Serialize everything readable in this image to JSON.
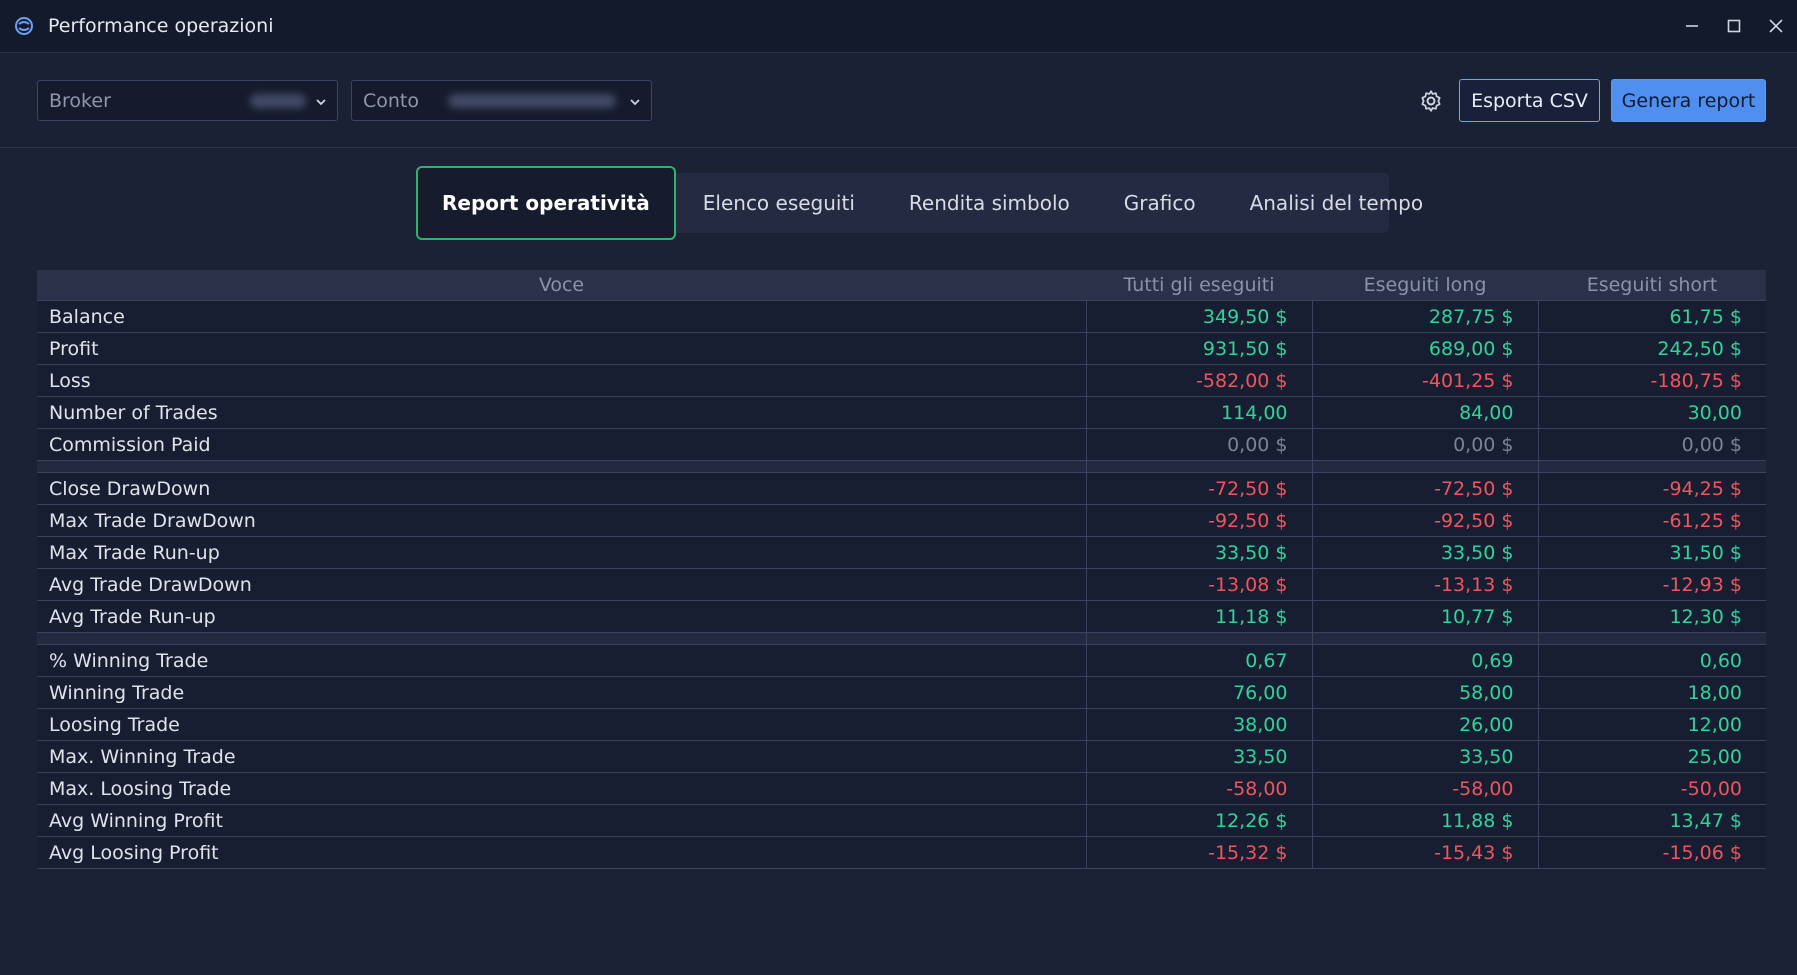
{
  "window": {
    "title": "Performance operazioni",
    "icons": [
      "app-logo-icon",
      "minimize-icon",
      "maximize-icon",
      "close-icon"
    ]
  },
  "toolbar": {
    "broker_label": "Broker",
    "account_label": "Conto",
    "export_label": "Esporta CSV",
    "report_label": "Genera report",
    "accent": "#4e8ff0"
  },
  "tabs": [
    {
      "label": "Report operatività",
      "active": true
    },
    {
      "label": "Elenco eseguiti",
      "active": false
    },
    {
      "label": "Rendita simbolo",
      "active": false
    },
    {
      "label": "Grafico",
      "active": false
    },
    {
      "label": "Analisi del tempo",
      "active": false
    }
  ],
  "table": {
    "headers": [
      "Voce",
      "Tutti gli eseguiti",
      "Eseguiti long",
      "Eseguiti short"
    ],
    "groups": [
      [
        {
          "label": "Balance",
          "values": [
            "349,50 $",
            "287,75 $",
            "61,75 $"
          ],
          "tone": "green"
        },
        {
          "label": "Profit",
          "values": [
            "931,50 $",
            "689,00 $",
            "242,50 $"
          ],
          "tone": "green"
        },
        {
          "label": "Loss",
          "values": [
            "-582,00 $",
            "-401,25 $",
            "-180,75 $"
          ],
          "tone": "red"
        },
        {
          "label": "Number of Trades",
          "values": [
            "114,00",
            "84,00",
            "30,00"
          ],
          "tone": "green"
        },
        {
          "label": "Commission Paid",
          "values": [
            "0,00 $",
            "0,00 $",
            "0,00 $"
          ],
          "tone": "grey"
        }
      ],
      [
        {
          "label": "Close DrawDown",
          "values": [
            "-72,50 $",
            "-72,50 $",
            "-94,25 $"
          ],
          "tone": "red"
        },
        {
          "label": "Max Trade DrawDown",
          "values": [
            "-92,50 $",
            "-92,50 $",
            "-61,25 $"
          ],
          "tone": "red"
        },
        {
          "label": "Max Trade Run-up",
          "values": [
            "33,50 $",
            "33,50 $",
            "31,50 $"
          ],
          "tone": "green"
        },
        {
          "label": "Avg Trade DrawDown",
          "values": [
            "-13,08 $",
            "-13,13 $",
            "-12,93 $"
          ],
          "tone": "red"
        },
        {
          "label": "Avg Trade Run-up",
          "values": [
            "11,18 $",
            "10,77 $",
            "12,30 $"
          ],
          "tone": "green"
        }
      ],
      [
        {
          "label": "% Winning Trade",
          "values": [
            "0,67",
            "0,69",
            "0,60"
          ],
          "tone": "green"
        },
        {
          "label": "Winning Trade",
          "values": [
            "76,00",
            "58,00",
            "18,00"
          ],
          "tone": "green"
        },
        {
          "label": "Loosing Trade",
          "values": [
            "38,00",
            "26,00",
            "12,00"
          ],
          "tone": "green"
        },
        {
          "label": "Max. Winning Trade",
          "values": [
            "33,50",
            "33,50",
            "25,00"
          ],
          "tone": "green"
        },
        {
          "label": "Max. Loosing Trade",
          "values": [
            "-58,00",
            "-58,00",
            "-50,00"
          ],
          "tone": "red"
        },
        {
          "label": "Avg Winning Profit",
          "values": [
            "12,26 $",
            "11,88 $",
            "13,47 $"
          ],
          "tone": "green"
        },
        {
          "label": "Avg Loosing Profit",
          "values": [
            "-15,32 $",
            "-15,43 $",
            "-15,06 $"
          ],
          "tone": "red"
        }
      ]
    ]
  },
  "colors": {
    "positive": "#2fd49a",
    "negative": "#f0545c",
    "neutral": "#7b8397",
    "active_tab_border": "#2fb467"
  }
}
